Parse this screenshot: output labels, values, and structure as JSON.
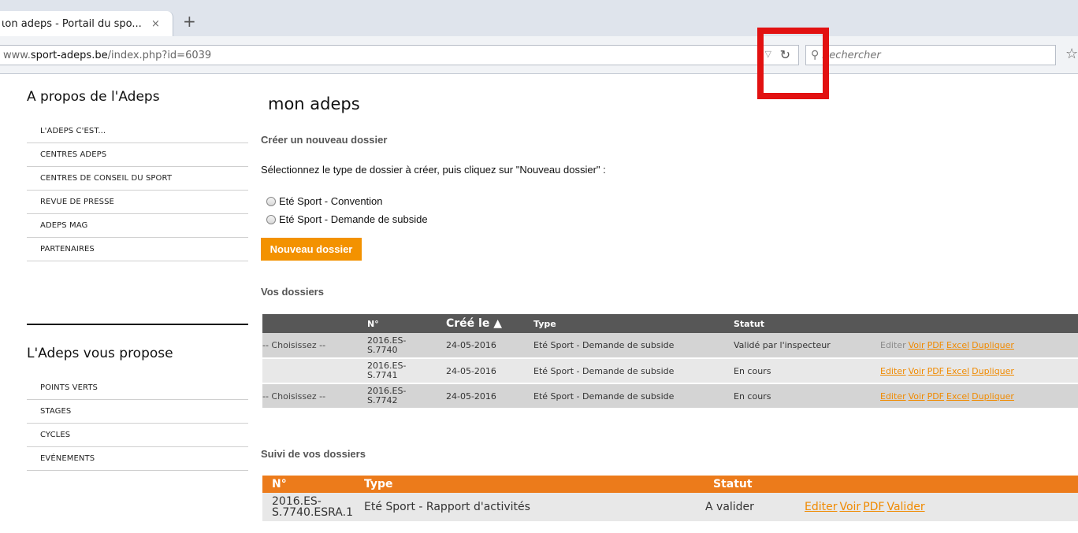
{
  "browser": {
    "tab_title": "ɩon adeps - Portail du spo...",
    "tab_close": "×",
    "new_tab": "+",
    "url_prefix": "www.",
    "url_domain": "sport-adeps.be",
    "url_path": "/index.php?id=6039",
    "search_placeholder": "Rechercher"
  },
  "sidebar": {
    "section1_title": "A propos de l'Adeps",
    "section1_items": [
      "L'ADEPS C'EST...",
      "CENTRES ADEPS",
      "CENTRES DE CONSEIL DU SPORT",
      "REVUE DE PRESSE",
      "ADEPS MAG",
      "PARTENAIRES"
    ],
    "section2_title": "L'Adeps vous propose",
    "section2_items": [
      "POINTS VERTS",
      "STAGES",
      "CYCLES",
      "EVÉNEMENTS"
    ]
  },
  "main": {
    "title": "mon adeps",
    "create_heading": "Créer un nouveau dossier",
    "intro": "Sélectionnez le type de dossier à créer, puis cliquez sur \"Nouveau dossier\" :",
    "options": [
      "Eté Sport - Convention",
      "Eté Sport - Demande de subside"
    ],
    "new_button": "Nouveau dossier",
    "dossiers_heading": "Vos dossiers",
    "dossiers_table": {
      "headers": [
        "N°",
        "Créé le ▲",
        "Type",
        "Statut"
      ],
      "rows": [
        {
          "select": "-- Choisissez --",
          "num1": "2016.ES-",
          "num2": "S.7740",
          "date": "24-05-2016",
          "type": "Eté Sport - Demande de subside",
          "status": "Validé par l'inspecteur",
          "actions": [
            "Editer",
            "Voir",
            "PDF",
            "Excel",
            "Dupliquer"
          ]
        },
        {
          "select": "",
          "num1": "2016.ES-",
          "num2": "S.7741",
          "date": "24-05-2016",
          "type": "Eté Sport - Demande de subside",
          "status": "En cours",
          "actions": [
            "Editer",
            "Voir",
            "PDF",
            "Excel",
            "Dupliquer"
          ]
        },
        {
          "select": "-- Choisissez --",
          "num1": "2016.ES-",
          "num2": "S.7742",
          "date": "24-05-2016",
          "type": "Eté Sport - Demande de subside",
          "status": "En cours",
          "actions": [
            "Editer",
            "Voir",
            "PDF",
            "Excel",
            "Dupliquer"
          ]
        }
      ]
    },
    "suivi_heading": "Suivi de vos dossiers",
    "suivi_table": {
      "headers": [
        "N°",
        "Type",
        "Statut"
      ],
      "rows": [
        {
          "num1": "2016.ES-",
          "num2": "S.7740.ESRA.1",
          "type": "Eté Sport - Rapport d'activités",
          "status": "A valider",
          "actions": [
            "Editer",
            "Voir",
            "PDF",
            "Valider"
          ]
        }
      ]
    }
  },
  "colors": {
    "accent": "#f39200",
    "table_header": "#575757",
    "suivi_header": "#ec7b1b",
    "highlight": "#e21111"
  }
}
